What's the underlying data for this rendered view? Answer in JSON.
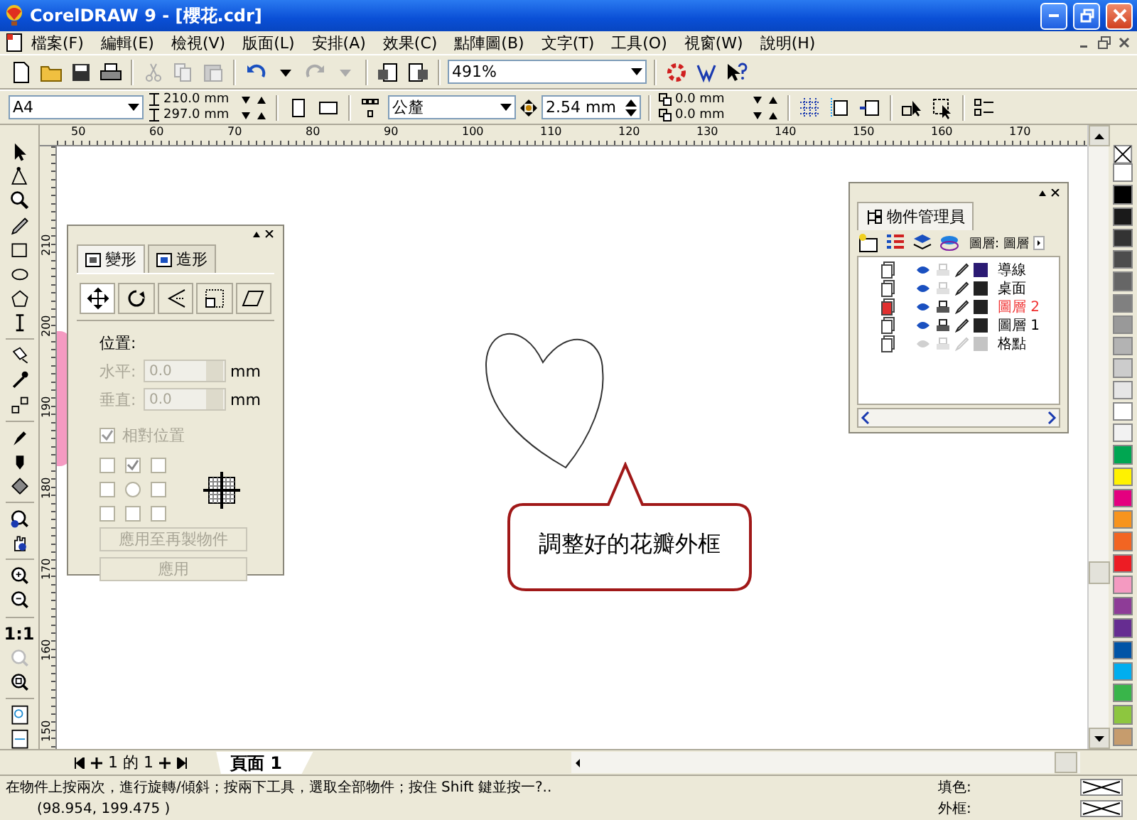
{
  "window": {
    "title": "CorelDRAW 9 - [櫻花.cdr]"
  },
  "menu": [
    {
      "label": "檔案(F)"
    },
    {
      "label": "編輯(E)"
    },
    {
      "label": "檢視(V)"
    },
    {
      "label": "版面(L)"
    },
    {
      "label": "安排(A)"
    },
    {
      "label": "效果(C)"
    },
    {
      "label": "點陣圖(B)"
    },
    {
      "label": "文字(T)"
    },
    {
      "label": "工具(O)"
    },
    {
      "label": "視窗(W)"
    },
    {
      "label": "說明(H)"
    }
  ],
  "standard_toolbar": {
    "zoom": "491%"
  },
  "property_bar": {
    "paper": "A4",
    "width": "210.0 mm",
    "height": "297.0 mm",
    "units": "公釐",
    "nudge": "2.54 mm",
    "duplicate_x": "0.0 mm",
    "duplicate_y": "0.0 mm"
  },
  "toolbox": {
    "actual_size": "1:1"
  },
  "rulers": {
    "horizontal": [
      "50",
      "60",
      "70",
      "80",
      "90",
      "100",
      "110",
      "120",
      "130",
      "140",
      "150",
      "160",
      "170"
    ],
    "vertical": [
      "210",
      "200",
      "190",
      "180",
      "170",
      "160",
      "150"
    ]
  },
  "palette": [
    {
      "color": "#ffffff"
    },
    {
      "color": "#000000"
    },
    {
      "color": "#1a1a1a"
    },
    {
      "color": "#333333"
    },
    {
      "color": "#4d4d4d"
    },
    {
      "color": "#666666"
    },
    {
      "color": "#808080"
    },
    {
      "color": "#999999"
    },
    {
      "color": "#b3b3b3"
    },
    {
      "color": "#cccccc"
    },
    {
      "color": "#e6e6e6"
    },
    {
      "color": "#ffffff"
    },
    {
      "color": "#f2f2f2"
    },
    {
      "color": "#00a651"
    },
    {
      "color": "#fff200"
    },
    {
      "color": "#e4007f"
    },
    {
      "color": "#f7941d"
    },
    {
      "color": "#f26522"
    },
    {
      "color": "#ed1c24"
    },
    {
      "color": "#f49ac1"
    },
    {
      "color": "#8e3c97"
    },
    {
      "color": "#662d91"
    },
    {
      "color": "#0054a6"
    },
    {
      "color": "#00aeef"
    },
    {
      "color": "#39b54a"
    },
    {
      "color": "#8dc63f"
    },
    {
      "color": "#c69c6d"
    }
  ],
  "transform_docker": {
    "tabs": [
      {
        "label": "變形",
        "selected": true
      },
      {
        "label": "造形",
        "selected": false
      }
    ],
    "position_label": "位置:",
    "disabled": true,
    "fields": [
      {
        "label": "水平:",
        "value": "0.0",
        "unit": "mm"
      },
      {
        "label": "垂直:",
        "value": "0.0",
        "unit": "mm"
      }
    ],
    "relative_position": {
      "label": "相對位置",
      "checked": true
    },
    "anchors": [
      {
        "selected": false
      },
      {
        "selected": true
      },
      {
        "selected": false
      },
      {
        "selected": false
      },
      {
        "selected": false
      },
      {
        "selected": false
      },
      {
        "selected": false
      },
      {
        "selected": false
      },
      {
        "selected": false
      }
    ],
    "buttons": [
      {
        "label": "應用至再製物件"
      },
      {
        "label": "應用"
      }
    ]
  },
  "object_manager": {
    "title": "物件管理員",
    "layer_label": "圖層: 圖層",
    "layers": [
      {
        "name": "導線",
        "visible": true,
        "printable": false,
        "editable": true,
        "selected": false,
        "color": "#2b1a73"
      },
      {
        "name": "桌面",
        "visible": true,
        "printable": false,
        "editable": true,
        "selected": false,
        "color": "#222222"
      },
      {
        "name": "圖層 2",
        "visible": true,
        "printable": true,
        "editable": true,
        "selected": true,
        "color": "#222222"
      },
      {
        "name": "圖層 1",
        "visible": true,
        "printable": true,
        "editable": true,
        "selected": false,
        "color": "#222222"
      },
      {
        "name": "格點",
        "visible": false,
        "printable": false,
        "editable": false,
        "selected": false,
        "color": "#c4c4c4"
      }
    ]
  },
  "callout": {
    "text": "調整好的花瓣外框"
  },
  "page_nav": {
    "counter": "1 的 1",
    "tabs": [
      {
        "label": "頁面 1",
        "selected": true
      }
    ]
  },
  "status_bar": {
    "hint": "在物件上按兩次，進行旋轉/傾斜；按兩下工具，選取全部物件；按住 Shift 鍵並按一?..",
    "coordinates": "(98.954, 199.475 )",
    "fill_label": "填色:",
    "outline_label": "外框:"
  }
}
